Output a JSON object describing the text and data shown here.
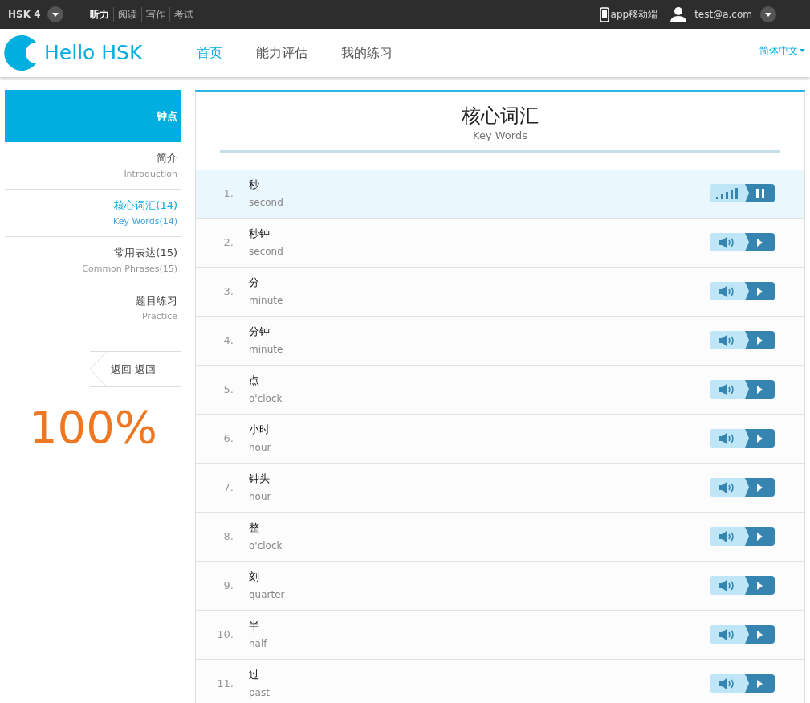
{
  "top_bar": {
    "level_label": "HSK 4",
    "sections": [
      {
        "label": "听力",
        "selected": true
      },
      {
        "label": "阅读",
        "selected": false
      },
      {
        "label": "写作",
        "selected": false
      },
      {
        "label": "考试",
        "selected": false
      }
    ],
    "app_link": "app移动端",
    "user": "test@a.com"
  },
  "header": {
    "logo": "Hello HSK",
    "nav": [
      {
        "label": "首页",
        "selected": true
      },
      {
        "label": "能力评估",
        "selected": false
      },
      {
        "label": "我的练习",
        "selected": false
      }
    ],
    "language": "简体中文"
  },
  "sidebar": {
    "title": "钟点",
    "items": [
      {
        "label": "简介",
        "sublabel": "Introduction",
        "selected": false
      },
      {
        "label": "核心词汇(14)",
        "sublabel": "Key Words(14)",
        "selected": true
      },
      {
        "label": "常用表达(15)",
        "sublabel": "Common Phrases(15)",
        "selected": false
      },
      {
        "label": "题目练习",
        "sublabel": "Practice",
        "selected": false
      }
    ],
    "back_button": "返回 返回",
    "progress": "100%"
  },
  "main": {
    "title": "核心词汇",
    "subtitle": "Key Words",
    "words": [
      {
        "number": "1.",
        "word": "秒",
        "meaning": "second",
        "playing": true
      },
      {
        "number": "2.",
        "word": "秒钟",
        "meaning": "second",
        "playing": false
      },
      {
        "number": "3.",
        "word": "分",
        "meaning": "minute",
        "playing": false
      },
      {
        "number": "4.",
        "word": "分钟",
        "meaning": "minute",
        "playing": false
      },
      {
        "number": "5.",
        "word": "点",
        "meaning": "o'clock",
        "playing": false
      },
      {
        "number": "6.",
        "word": "小时",
        "meaning": "hour",
        "playing": false
      },
      {
        "number": "7.",
        "word": "钟头",
        "meaning": "hour",
        "playing": false
      },
      {
        "number": "8.",
        "word": "整",
        "meaning": "o'clock",
        "playing": false
      },
      {
        "number": "9.",
        "word": "刻",
        "meaning": "quarter",
        "playing": false
      },
      {
        "number": "10.",
        "word": "半",
        "meaning": "half",
        "playing": false
      },
      {
        "number": "11.",
        "word": "过",
        "meaning": "past",
        "playing": false
      }
    ]
  }
}
